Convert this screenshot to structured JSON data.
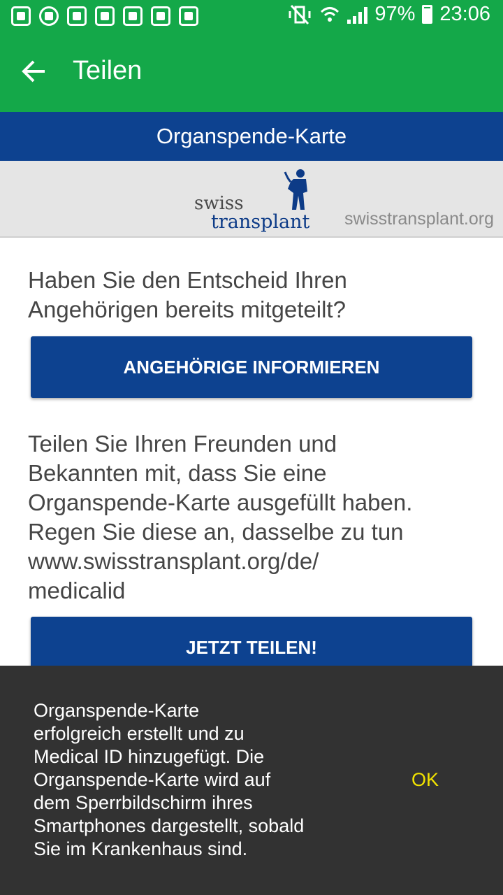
{
  "status_bar": {
    "battery": "97%",
    "time": "23:06"
  },
  "app_bar": {
    "title": "Teilen",
    "back_icon": "arrow-left-icon"
  },
  "banner": {
    "title": "Organspende-Karte"
  },
  "logo": {
    "line1": "swiss",
    "line2": "transplant",
    "website": "swisstransplant.org"
  },
  "content": {
    "question": "Haben Sie den Entscheid Ihren Angehörigen bereits mitgeteilt?",
    "inform_button": "ANGEHÖRIGE INFORMIEREN",
    "share_text_lines": [
      "Teilen Sie Ihren Freunden und",
      "Bekannten mit, dass Sie eine",
      "Organspende-Karte ausgefüllt haben.",
      "Regen Sie diese an, dasselbe zu tun",
      "www.swisstransplant.org/de/",
      "medicalid"
    ],
    "share_button": "JETZT TEILEN!"
  },
  "snackbar": {
    "message_lines": [
      "Organspende-Karte",
      "erfolgreich erstellt und zu",
      "Medical ID hinzugefügt. Die",
      "Organspende-Karte wird auf",
      "dem Sperrbildschirm ihres",
      "Smartphones dargestellt, sobald",
      "Sie im Krankenhaus sind."
    ],
    "action": "OK"
  },
  "colors": {
    "app_bar": "#14a849",
    "brand_blue": "#0d4290",
    "snackbar_bg": "#323232",
    "snackbar_action": "#f2e300"
  }
}
